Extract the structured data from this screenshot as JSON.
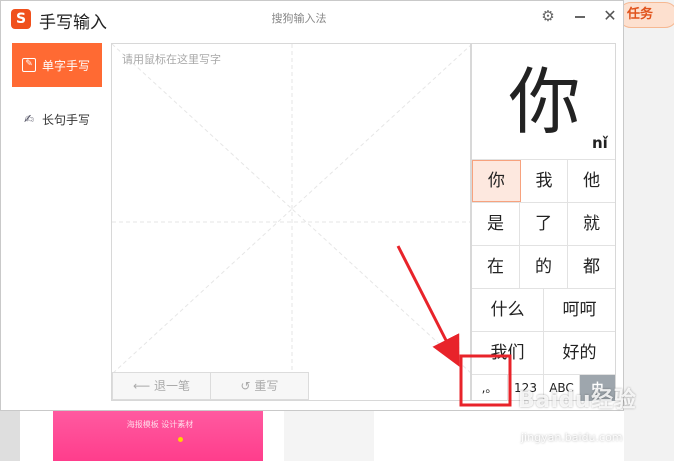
{
  "background": {
    "task_badge": "任务",
    "banner_text": "海报模板 设计素材"
  },
  "window": {
    "app_title": "手写输入",
    "center_title": "搜狗输入法",
    "logo_letter": "S"
  },
  "sidebar": {
    "items": [
      {
        "label": "单字手写",
        "icon": "single-char-icon",
        "active": true
      },
      {
        "label": "长句手写",
        "icon": "sentence-icon",
        "active": false
      }
    ]
  },
  "canvas": {
    "hint": "请用鼠标在这里写字",
    "undo_label": "退一笔",
    "rewrite_label": "重写"
  },
  "panel": {
    "preview_char": "你",
    "preview_pinyin": "nǐ",
    "rows": [
      [
        "你",
        "我",
        "他"
      ],
      [
        "是",
        "了",
        "就"
      ],
      [
        "在",
        "的",
        "都"
      ],
      [
        "什么",
        "呵呵"
      ],
      [
        "我们",
        "好的"
      ]
    ],
    "modes": [
      ",。",
      "123",
      "ABC",
      "中"
    ],
    "active_mode": "中"
  },
  "watermark": {
    "main": "Baidu经验",
    "sub": "jingyan.baidu.com"
  },
  "colors": {
    "accent": "#ff6a33",
    "annotation": "#e8232a",
    "selected_cell": "#fde8df"
  }
}
